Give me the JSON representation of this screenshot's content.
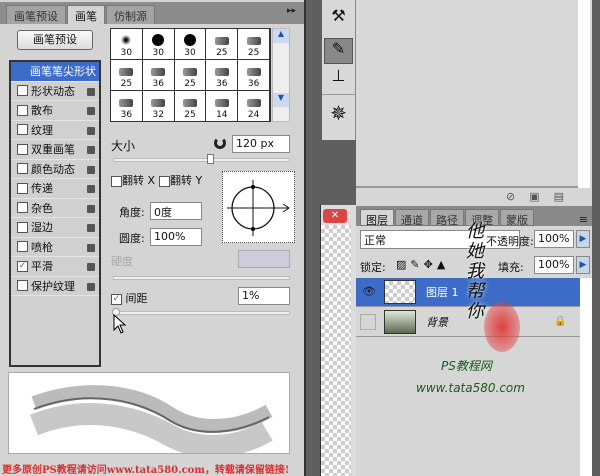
{
  "brush_panel": {
    "tabs": [
      {
        "label": "画笔预设"
      },
      {
        "label": "画笔"
      },
      {
        "label": "仿制源"
      }
    ],
    "menu_icon": "double-chevron-right-icon",
    "preset_button": "画笔预设",
    "options": [
      {
        "label": "画笔笔尖形状",
        "selected": true
      },
      {
        "label": "形状动态",
        "checked": false
      },
      {
        "label": "散布",
        "checked": false
      },
      {
        "label": "纹理",
        "checked": false
      },
      {
        "label": "双重画笔",
        "checked": false
      },
      {
        "label": "颜色动态",
        "checked": false
      },
      {
        "label": "传递",
        "checked": false
      },
      {
        "label": "杂色",
        "checked": false
      },
      {
        "label": "湿边",
        "checked": false
      },
      {
        "label": "喷枪",
        "checked": false
      },
      {
        "label": "平滑",
        "checked": true
      },
      {
        "label": "保护纹理",
        "checked": false
      }
    ],
    "brush_sizes": [
      "30",
      "30",
      "30",
      "25",
      "25",
      "25",
      "36",
      "25",
      "36",
      "36",
      "36",
      "32",
      "25",
      "14",
      "24"
    ],
    "size_label": "大小",
    "size_value": "120 px",
    "flip_x": "翻转 X",
    "flip_y": "翻转 Y",
    "angle_label": "角度:",
    "angle_value": "0度",
    "roundness_label": "圆度:",
    "roundness_value": "100%",
    "hardness_label": "硬度",
    "spacing_label": "间距",
    "spacing_checked": true,
    "spacing_value": "1%"
  },
  "layers_panel": {
    "tabs": [
      {
        "label": "图层"
      },
      {
        "label": "通道"
      },
      {
        "label": "路径"
      },
      {
        "label": "调整"
      },
      {
        "label": "蒙版"
      }
    ],
    "blend_mode": "正常",
    "opacity_label": "不透明度:",
    "opacity_value": "100%",
    "lock_label": "锁定:",
    "fill_label": "填充:",
    "fill_value": "100%",
    "layers": [
      {
        "name": "图层 1",
        "selected": true,
        "visible": true
      },
      {
        "name": "背景",
        "selected": false,
        "visible": false,
        "locked": true
      }
    ]
  },
  "watermarks": {
    "seal": "他她我帮你",
    "site_name": "PS教程网",
    "site_url": "www.tata580.com",
    "footer": "更多原创PS教程请访问www.tata580.com，转载请保留链接!"
  },
  "colors": {
    "selection": "#3c6cc8",
    "watermark": "#d83030"
  }
}
